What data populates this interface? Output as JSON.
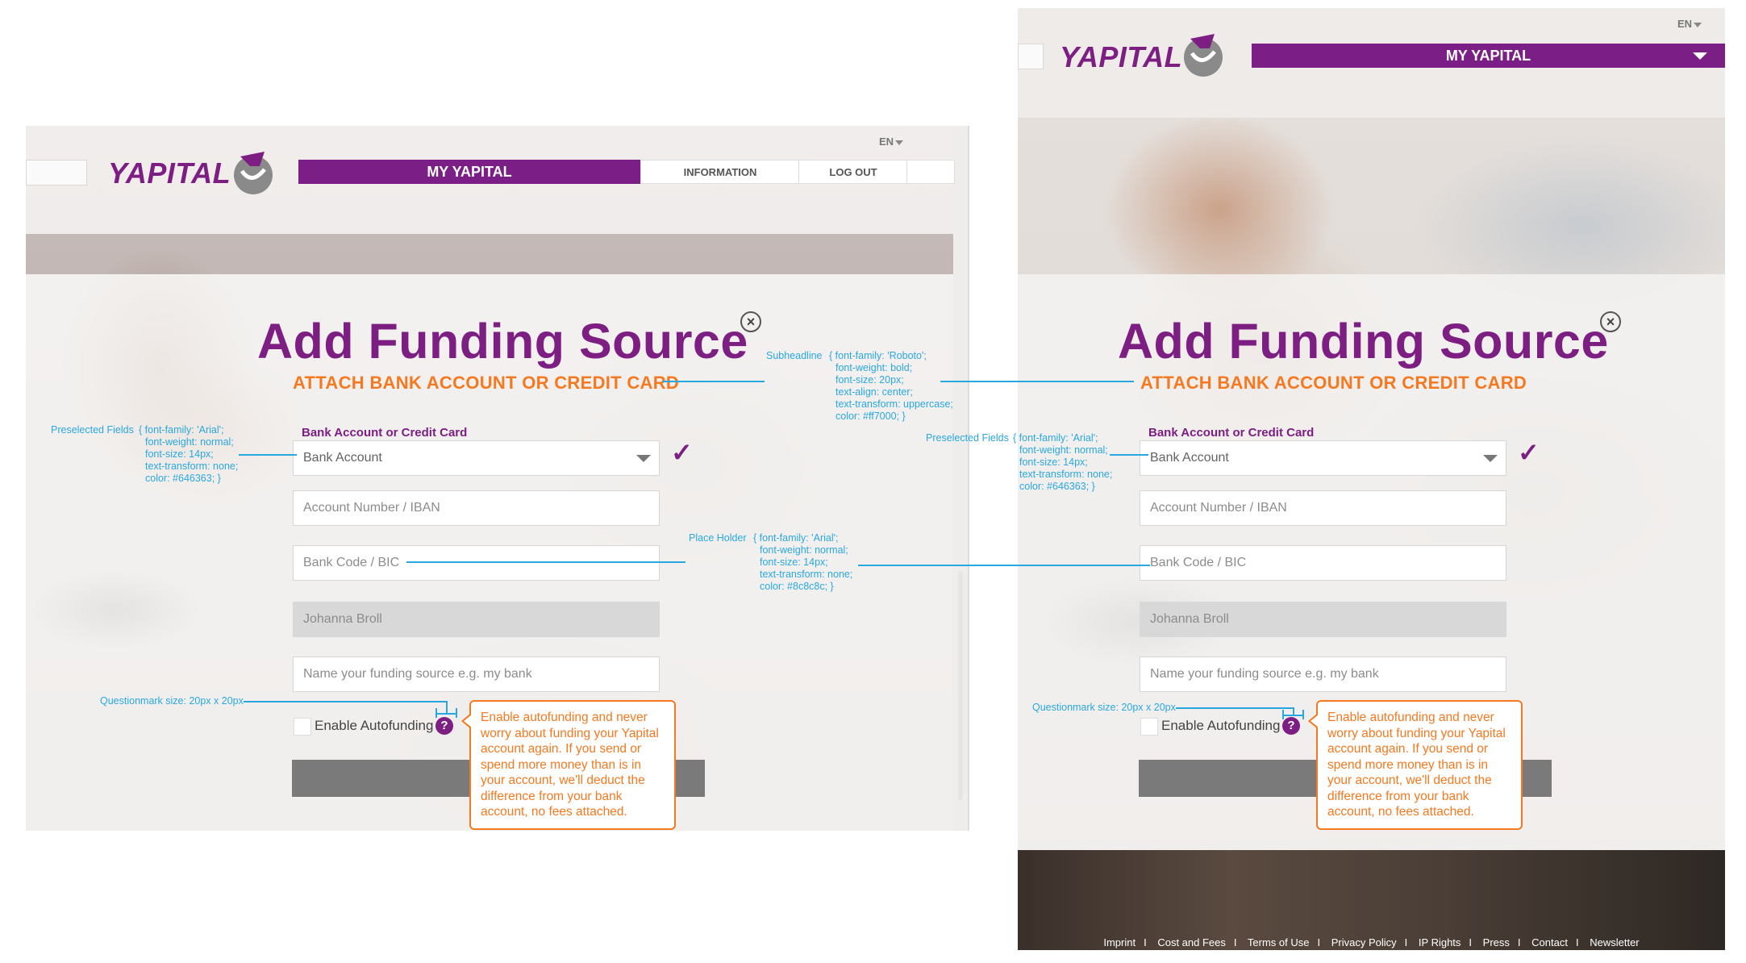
{
  "brand": {
    "name": "YAPITAL",
    "primary_color": "#7d1e83",
    "accent_color": "#f47920",
    "annotation_color": "#29a8e0"
  },
  "header": {
    "language": "EN",
    "nav_primary": "MY YAPITAL",
    "nav_information": "INFORMATION",
    "nav_logout": "LOG OUT"
  },
  "form": {
    "title": "Add Funding Source",
    "subtitle": "ATTACH BANK ACCOUNT OR CREDIT CARD",
    "select_label": "Bank Account or Credit Card",
    "select_value": "Bank Account",
    "account_placeholder": "Account Number / IBAN",
    "bank_code_placeholder": "Bank Code / BIC",
    "holder_name": "Johanna Broll",
    "source_name_placeholder": "Name your funding source e.g. my bank",
    "autofunding_label": "Enable Autofunding",
    "help_icon": "?",
    "tooltip": "Enable autofunding and never worry about funding your Yapital account again. If you send or spend more money than is in your account, we'll deduct the difference from your bank account, no fees attached."
  },
  "annotations": {
    "subheadline": {
      "label": "Subheadline",
      "spec": [
        "{ font-family: 'Roboto';",
        "font-weight: bold;",
        "font-size: 20px;",
        "text-align: center;",
        "text-transform: uppercase;",
        "color: #ff7000; }"
      ]
    },
    "preselected": {
      "label": "Preselected Fields",
      "spec": [
        "{ font-family: 'Arial';",
        "font-weight: normal;",
        "font-size: 14px;",
        "text-transform: none;",
        "color: #646363; }"
      ]
    },
    "placeholder": {
      "label": "Place Holder",
      "spec": [
        "{ font-family: 'Arial';",
        "font-weight: normal;",
        "font-size: 14px;",
        "text-transform: none;",
        "color: #8c8c8c; }"
      ]
    },
    "questionmark": "Questionmark size: 20px x 20px"
  },
  "footer": {
    "links": [
      "Imprint",
      "Cost and Fees",
      "Terms of Use",
      "Privacy Policy",
      "IP Rights",
      "Press",
      "Contact",
      "Newsletter"
    ]
  }
}
